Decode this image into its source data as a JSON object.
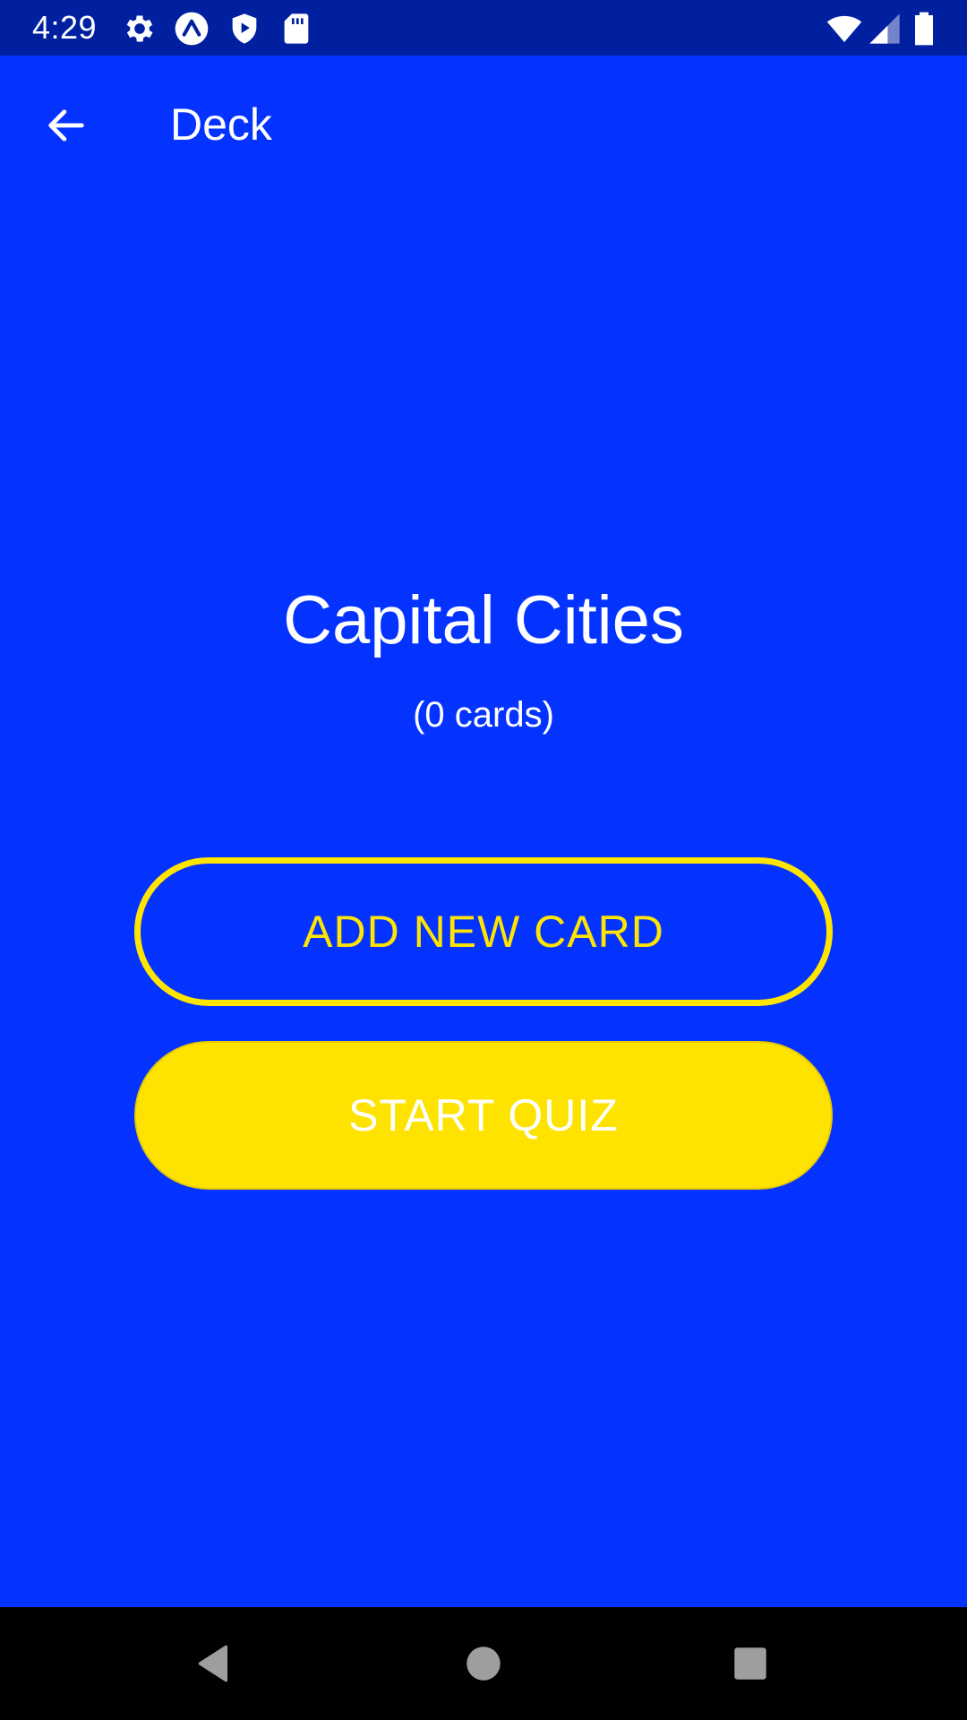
{
  "status_bar": {
    "time": "4:29",
    "icons": [
      "gear-icon",
      "expo-icon",
      "shield-play-icon",
      "sd-card-icon",
      "wifi-icon",
      "cell-signal-icon",
      "battery-icon"
    ]
  },
  "app_bar": {
    "back_icon": "arrow-left-icon",
    "title": "Deck"
  },
  "deck": {
    "title": "Capital Cities",
    "count_text": "(0 cards)"
  },
  "actions": {
    "add_card_label": "ADD NEW CARD",
    "start_quiz_label": "START QUIZ"
  },
  "nav_bar": {
    "icons": [
      "back-triangle-icon",
      "home-circle-icon",
      "recents-square-icon"
    ]
  },
  "colors": {
    "background": "#0433FF",
    "status_bar": "#0020A0",
    "accent": "#FFE500",
    "text": "#FFFFFF",
    "nav_bar": "#000000"
  }
}
